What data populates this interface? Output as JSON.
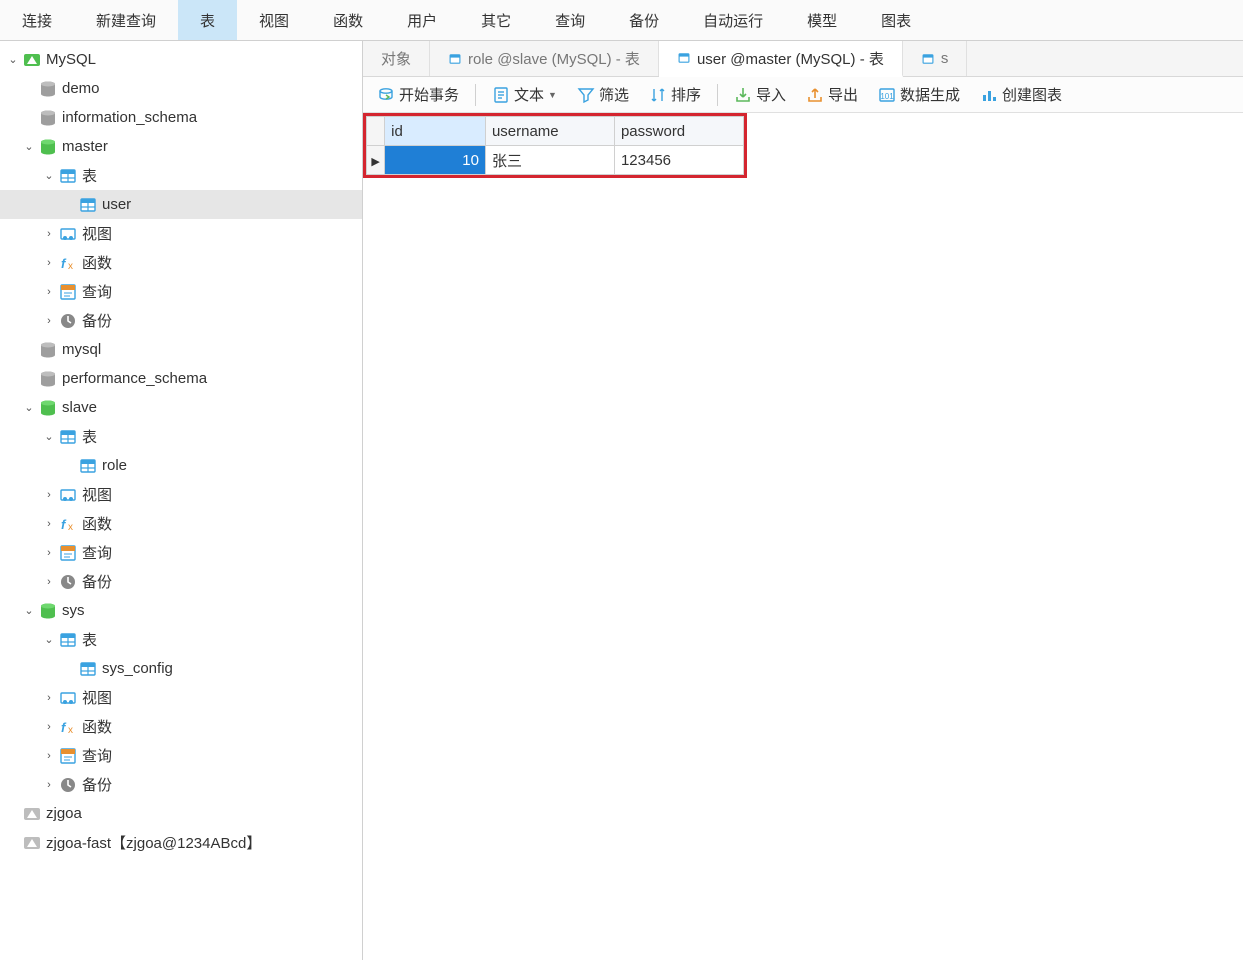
{
  "toolbar": {
    "items": [
      {
        "id": "connect",
        "label": "连接"
      },
      {
        "id": "new-query",
        "label": "新建查询"
      },
      {
        "id": "table",
        "label": "表",
        "active": true
      },
      {
        "id": "view",
        "label": "视图"
      },
      {
        "id": "function",
        "label": "函数"
      },
      {
        "id": "user",
        "label": "用户"
      },
      {
        "id": "other",
        "label": "其它"
      },
      {
        "id": "query",
        "label": "查询"
      },
      {
        "id": "backup",
        "label": "备份"
      },
      {
        "id": "auto-run",
        "label": "自动运行"
      },
      {
        "id": "model",
        "label": "模型"
      },
      {
        "id": "chart",
        "label": "图表"
      }
    ]
  },
  "sidebar": {
    "tree": [
      {
        "depth": 0,
        "exp": "open",
        "icon": "conn-green",
        "label": "MySQL",
        "name": "connection-mysql"
      },
      {
        "depth": 1,
        "exp": "none",
        "icon": "db-grey",
        "label": "demo",
        "name": "db-demo"
      },
      {
        "depth": 1,
        "exp": "none",
        "icon": "db-grey",
        "label": "information_schema",
        "name": "db-information-schema"
      },
      {
        "depth": 1,
        "exp": "open",
        "icon": "db-green",
        "label": "master",
        "name": "db-master"
      },
      {
        "depth": 2,
        "exp": "open",
        "icon": "table-group",
        "label": "表",
        "name": "group-tables-master"
      },
      {
        "depth": 3,
        "exp": "none",
        "icon": "table",
        "label": "user",
        "name": "table-user",
        "selected": true
      },
      {
        "depth": 2,
        "exp": "closed",
        "icon": "view",
        "label": "视图",
        "name": "group-views-master"
      },
      {
        "depth": 2,
        "exp": "closed",
        "icon": "fx",
        "label": "函数",
        "name": "group-functions-master"
      },
      {
        "depth": 2,
        "exp": "closed",
        "icon": "query",
        "label": "查询",
        "name": "group-queries-master"
      },
      {
        "depth": 2,
        "exp": "closed",
        "icon": "backup",
        "label": "备份",
        "name": "group-backup-master"
      },
      {
        "depth": 1,
        "exp": "none",
        "icon": "db-grey",
        "label": "mysql",
        "name": "db-mysql"
      },
      {
        "depth": 1,
        "exp": "none",
        "icon": "db-grey",
        "label": "performance_schema",
        "name": "db-performance-schema"
      },
      {
        "depth": 1,
        "exp": "open",
        "icon": "db-green",
        "label": "slave",
        "name": "db-slave"
      },
      {
        "depth": 2,
        "exp": "open",
        "icon": "table-group",
        "label": "表",
        "name": "group-tables-slave"
      },
      {
        "depth": 3,
        "exp": "none",
        "icon": "table",
        "label": "role",
        "name": "table-role"
      },
      {
        "depth": 2,
        "exp": "closed",
        "icon": "view",
        "label": "视图",
        "name": "group-views-slave"
      },
      {
        "depth": 2,
        "exp": "closed",
        "icon": "fx",
        "label": "函数",
        "name": "group-functions-slave"
      },
      {
        "depth": 2,
        "exp": "closed",
        "icon": "query",
        "label": "查询",
        "name": "group-queries-slave"
      },
      {
        "depth": 2,
        "exp": "closed",
        "icon": "backup",
        "label": "备份",
        "name": "group-backup-slave"
      },
      {
        "depth": 1,
        "exp": "open",
        "icon": "db-green",
        "label": "sys",
        "name": "db-sys"
      },
      {
        "depth": 2,
        "exp": "open",
        "icon": "table-group",
        "label": "表",
        "name": "group-tables-sys"
      },
      {
        "depth": 3,
        "exp": "none",
        "icon": "table",
        "label": "sys_config",
        "name": "table-sys-config"
      },
      {
        "depth": 2,
        "exp": "closed",
        "icon": "view",
        "label": "视图",
        "name": "group-views-sys"
      },
      {
        "depth": 2,
        "exp": "closed",
        "icon": "fx",
        "label": "函数",
        "name": "group-functions-sys"
      },
      {
        "depth": 2,
        "exp": "closed",
        "icon": "query",
        "label": "查询",
        "name": "group-queries-sys"
      },
      {
        "depth": 2,
        "exp": "closed",
        "icon": "backup",
        "label": "备份",
        "name": "group-backup-sys"
      },
      {
        "depth": 0,
        "exp": "none",
        "icon": "conn-grey",
        "label": "zjgoa",
        "name": "connection-zjgoa"
      },
      {
        "depth": 0,
        "exp": "none",
        "icon": "conn-grey",
        "label": "zjgoa-fast【zjgoa@1234ABcd】",
        "name": "connection-zjgoa-fast"
      }
    ]
  },
  "contentTabs": {
    "items": [
      {
        "id": "objects",
        "label": "对象",
        "icon": "none"
      },
      {
        "id": "role-slave",
        "label": "role @slave (MySQL) - 表",
        "icon": "table"
      },
      {
        "id": "user-master",
        "label": "user @master (MySQL) - 表",
        "icon": "table",
        "active": true
      },
      {
        "id": "extra",
        "label": "s",
        "icon": "table"
      }
    ]
  },
  "actions": {
    "begin_txn": "开始事务",
    "text": "文本",
    "filter": "筛选",
    "sort": "排序",
    "import": "导入",
    "export": "导出",
    "gen_data": "数据生成",
    "create_chart": "创建图表"
  },
  "grid": {
    "columns": [
      "id",
      "username",
      "password"
    ],
    "selectedColumn": 0,
    "rows": [
      {
        "id": "10",
        "username": "张三",
        "password": "123456"
      }
    ]
  }
}
